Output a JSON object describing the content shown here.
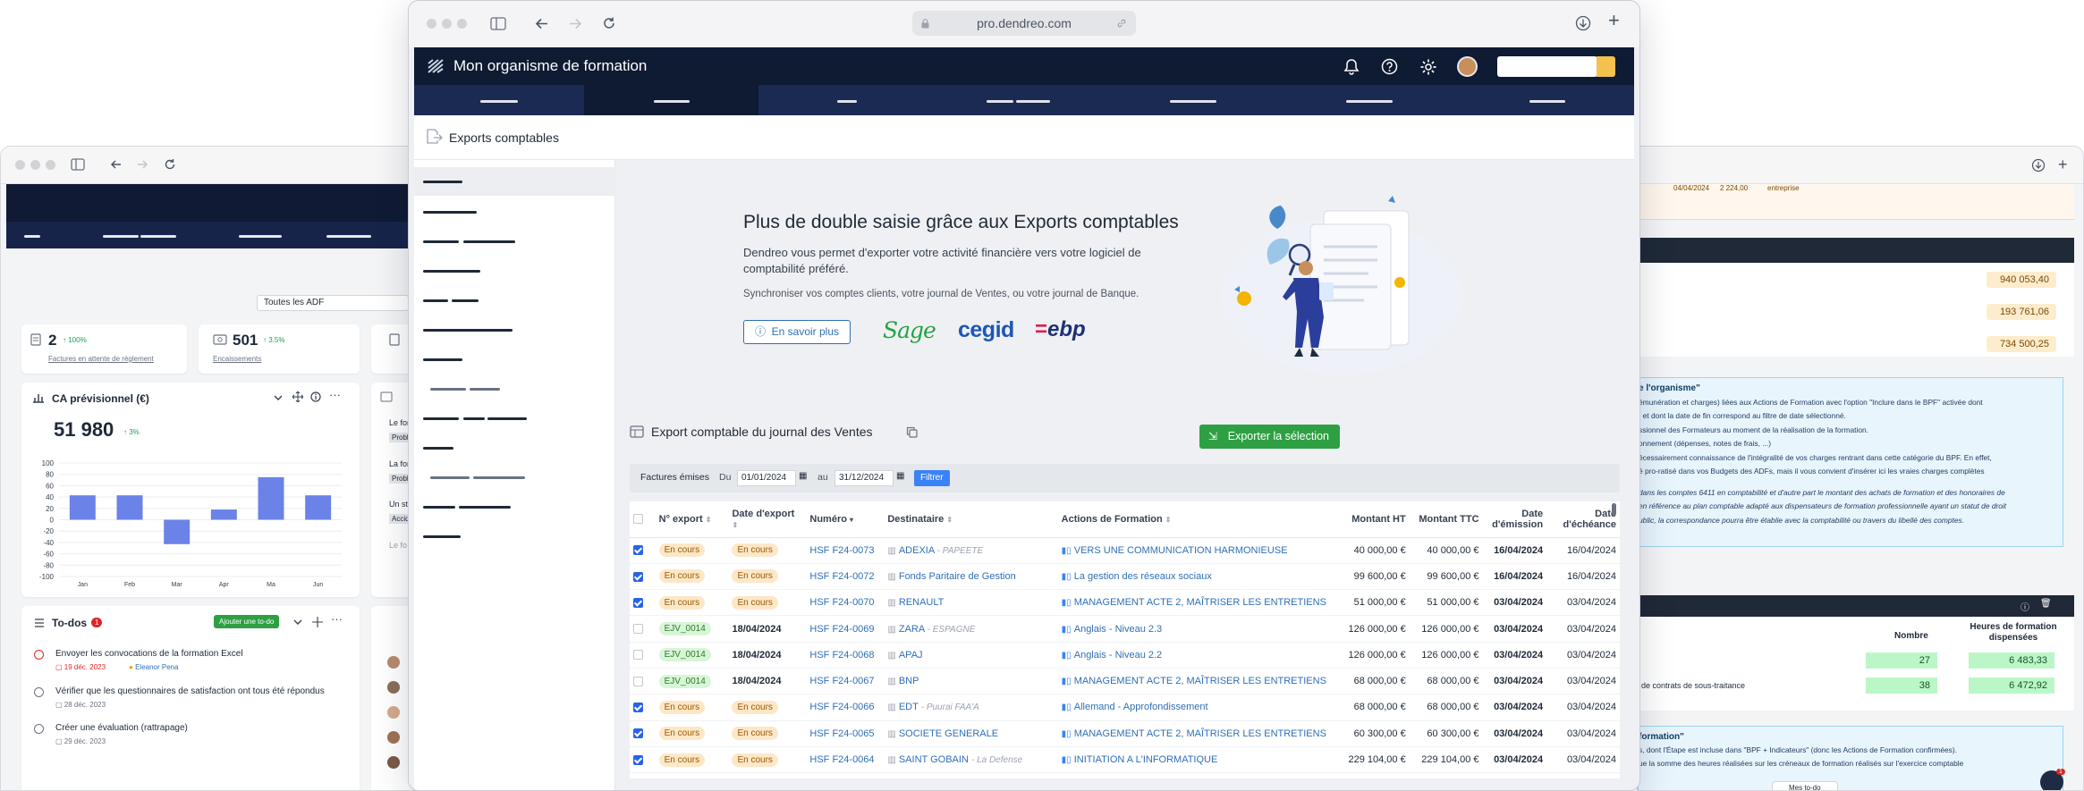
{
  "left_window": {
    "filter_select": "Toutes les ADF",
    "stats": [
      {
        "value": "2",
        "delta": "↑ 100%",
        "label": "Factures en attente de règlement"
      },
      {
        "value": "501",
        "delta": "↑ 3.5%",
        "label": "Encaissements"
      }
    ],
    "chart_card": {
      "title": "CA prévisionnel (€)",
      "total": "51 980",
      "delta": "↑ 3%"
    },
    "chart_data": {
      "type": "bar",
      "categories": [
        "Jan",
        "Feb",
        "Mar",
        "Apr",
        "Ma",
        "Jun"
      ],
      "values": [
        43,
        43,
        -43,
        18,
        75,
        43
      ],
      "ylim": [
        -100,
        100
      ],
      "yticks": [
        "100",
        "80",
        "60",
        "40",
        "20",
        "0",
        "-20",
        "-40",
        "-60",
        "-80",
        "-100"
      ],
      "color": "#6b83e8"
    },
    "partial_texts": [
      "Le for",
      "Probl",
      "La for",
      "Probl",
      "Un sta",
      "Accid",
      "Le fo"
    ],
    "todos": {
      "title": "To-dos",
      "count": "1",
      "add_label": "Ajouter une to-do",
      "items": [
        {
          "text": "Envoyer les convocations de la formation Excel",
          "date": "19 déc. 2023",
          "assignee": "Eleanor Pena",
          "late": true
        },
        {
          "text": "Vérifier que les questionnaires de satisfaction ont tous été répondus",
          "date": "28 déc. 2023"
        },
        {
          "text": "Créer une évaluation (rattrapage)",
          "date": "29 déc. 2023"
        }
      ]
    }
  },
  "right_window": {
    "top_row": {
      "date": "04/04/2024",
      "amount": "2 224,00",
      "type": "entreprise"
    },
    "values": [
      "940 053,40",
      "193 761,06",
      "734 500,25"
    ],
    "info_title": "e l'organisme\"",
    "info_lines": [
      "émunération et charges) liées aux Actions de Formation avec l'option \"Inclure dans le BPF\" activée dont",
      ", et dont la date de fin correspond au filtre de date sélectionné.",
      "ssionnel des Formateurs au moment de la réalisation de la formation.",
      "onnement (dépenses, notes de frais, ...)",
      "écessairement connaissance de l'intégralité de vos charges rentrant dans cette catégorie du BPF. En effet,",
      "é pro-ratisé dans vos Budgets des ADFs, mais il vous convient d'insérer ici les vraies charges complètes"
    ],
    "info_italic": [
      "dans les comptes 6411 en comptabilité et d'autre part le montant des achats de formation et des honoraires de",
      "en référence au plan comptable adapté aux dispensateurs de formation professionnelle ayant un statut de droit",
      "ublic, la correspondance pourra être établie avec la comptabilité ou travers du libellé des comptes."
    ],
    "table_headers": [
      "Nombre",
      "Heures de formation dispensées"
    ],
    "table_rows": [
      {
        "label": "",
        "nombre": "27",
        "heures": "6 483,33"
      },
      {
        "label": "de contrats de sous-traitance",
        "nombre": "38",
        "heures": "6 472,92"
      }
    ],
    "bottom_title": "formation\"",
    "bottom_lines": [
      "s, dont l'Étape est incluse dans \"BPF + Indicateurs\" (donc les Actions de Formation confirmées).",
      "ue la somme des heures réalisées sur les créneaux de formation réalisés sur l'exercice comptable"
    ],
    "mes_todo": "Mes to-do",
    "chat_badge": "1"
  },
  "main_window": {
    "url": "pro.dendreo.com",
    "org_name": "Mon organisme de formation",
    "page_title": "Exports comptables",
    "promo": {
      "title": "Plus de double saisie grâce aux Exports comptables",
      "text": "Dendreo vous permet d'exporter votre activité financière vers votre logiciel de comptabilité préféré.",
      "sub": "Synchroniser vos comptes clients, votre journal de Ventes, ou votre journal de Banque.",
      "learn_more": "En savoir plus",
      "logos": [
        "Sage",
        "cegid",
        "ebp"
      ]
    },
    "section_title": "Export comptable du journal des Ventes",
    "export_button": "Exporter la sélection",
    "filter": {
      "label": "Factures émises",
      "du": "Du",
      "from": "01/01/2024",
      "au": "au",
      "to": "31/12/2024",
      "button": "Filtrer"
    },
    "columns": [
      "N° export",
      "Date d'export",
      "Numéro",
      "Destinataire",
      "Actions de Formation",
      "Montant HT",
      "Montant TTC",
      "Date d'émission",
      "Date d'échéance"
    ],
    "rows": [
      {
        "checked": true,
        "export": "En cours",
        "date_export": "En cours",
        "numero": "HSF F24-0073",
        "dest": "ADEXIA",
        "dest_sub": "PAPEETE",
        "action": "VERS UNE COMMUNICATION HARMONIEUSE",
        "ht": "40 000,00 €",
        "ttc": "40 000,00 €",
        "emission": "16/04/2024",
        "echeance": "16/04/2024"
      },
      {
        "checked": true,
        "export": "En cours",
        "date_export": "En cours",
        "numero": "HSF F24-0072",
        "dest": "Fonds Paritaire de Gestion",
        "dest_sub": "",
        "action": "La gestion des réseaux sociaux",
        "ht": "99 600,00 €",
        "ttc": "99 600,00 €",
        "emission": "16/04/2024",
        "echeance": "16/04/2024"
      },
      {
        "checked": true,
        "export": "En cours",
        "date_export": "En cours",
        "numero": "HSF F24-0070",
        "dest": "RENAULT",
        "dest_sub": "",
        "action": "MANAGEMENT ACTE 2, MAÎTRISER LES ENTRETIENS",
        "ht": "51 000,00 €",
        "ttc": "51 000,00 €",
        "emission": "03/04/2024",
        "echeance": "03/04/2024"
      },
      {
        "checked": false,
        "export": "EJV_0014",
        "date_export": "18/04/2024",
        "numero": "HSF F24-0069",
        "dest": "ZARA",
        "dest_sub": "ESPAGNE",
        "action": "Anglais - Niveau 2.3",
        "ht": "126 000,00 €",
        "ttc": "126 000,00 €",
        "emission": "03/04/2024",
        "echeance": "03/04/2024"
      },
      {
        "checked": false,
        "export": "EJV_0014",
        "date_export": "18/04/2024",
        "numero": "HSF F24-0068",
        "dest": "APAJ",
        "dest_sub": "",
        "action": "Anglais - Niveau 2.2",
        "ht": "126 000,00 €",
        "ttc": "126 000,00 €",
        "emission": "03/04/2024",
        "echeance": "03/04/2024"
      },
      {
        "checked": false,
        "export": "EJV_0014",
        "date_export": "18/04/2024",
        "numero": "HSF F24-0067",
        "dest": "BNP",
        "dest_sub": "",
        "action": "MANAGEMENT ACTE 2, MAÎTRISER LES ENTRETIENS",
        "ht": "68 000,00 €",
        "ttc": "68 000,00 €",
        "emission": "03/04/2024",
        "echeance": "03/04/2024"
      },
      {
        "checked": true,
        "export": "En cours",
        "date_export": "En cours",
        "numero": "HSF F24-0066",
        "dest": "EDT",
        "dest_sub": "Puurai FAA'A",
        "action": "Allemand - Approfondissement",
        "ht": "68 000,00 €",
        "ttc": "68 000,00 €",
        "emission": "03/04/2024",
        "echeance": "03/04/2024"
      },
      {
        "checked": true,
        "export": "En cours",
        "date_export": "En cours",
        "numero": "HSF F24-0065",
        "dest": "SOCIETE GENERALE",
        "dest_sub": "",
        "action": "MANAGEMENT ACTE 2, MAÎTRISER LES ENTRETIENS",
        "ht": "60 300,00 €",
        "ttc": "60 300,00 €",
        "emission": "03/04/2024",
        "echeance": "03/04/2024"
      },
      {
        "checked": true,
        "export": "En cours",
        "date_export": "En cours",
        "numero": "HSF F24-0064",
        "dest": "SAINT GOBAIN",
        "dest_sub": "La Defense",
        "action": "INITIATION A L'INFORMATIQUE",
        "ht": "229 104,00 €",
        "ttc": "229 104,00 €",
        "emission": "03/04/2024",
        "echeance": "03/04/2024"
      }
    ]
  },
  "colors": {
    "navy": "#0f1a33",
    "accent_green": "#2ea043",
    "link_blue": "#2f6fb6",
    "filter_blue": "#3b82f6"
  }
}
